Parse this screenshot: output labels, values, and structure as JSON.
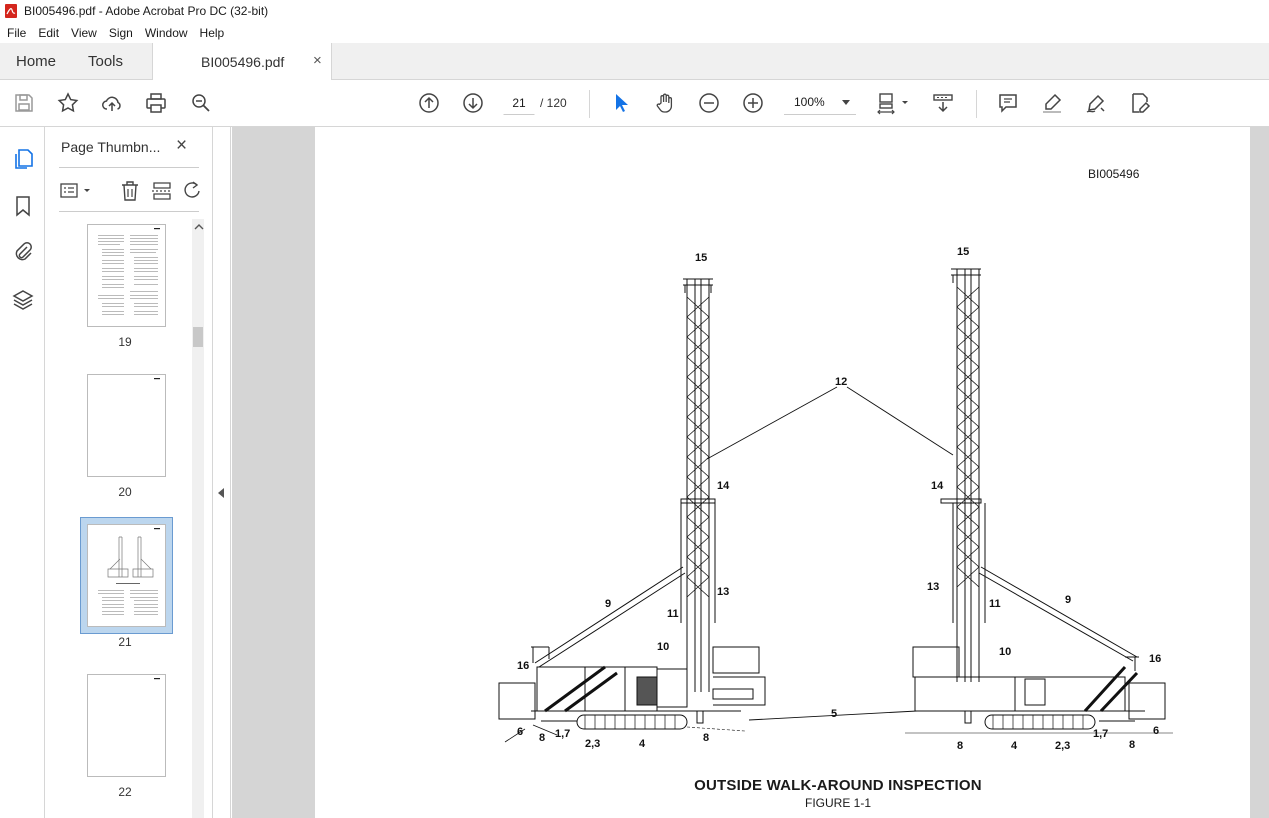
{
  "window": {
    "title": "BI005496.pdf - Adobe Acrobat Pro DC (32-bit)"
  },
  "menu": [
    "File",
    "Edit",
    "View",
    "Sign",
    "Window",
    "Help"
  ],
  "tabs": {
    "home": "Home",
    "tools": "Tools",
    "document": "BI005496.pdf",
    "close": "×"
  },
  "toolbar": {
    "current_page": "21",
    "page_total": "/ 120",
    "zoom": "100%"
  },
  "sidebar": {
    "title": "Page Thumbn...",
    "close": "×",
    "thumbnails": [
      {
        "label": "19"
      },
      {
        "label": "20"
      },
      {
        "label": "21",
        "selected": true
      },
      {
        "label": "22"
      }
    ]
  },
  "document": {
    "doc_id": "BI005496",
    "caption": "OUTSIDE WALK-AROUND INSPECTION",
    "figure": "FIGURE 1-1",
    "callouts_left": [
      "15",
      "12",
      "14",
      "13",
      "9",
      "11",
      "10",
      "16",
      "5",
      "6",
      "8",
      "1,7",
      "2,3",
      "4",
      "8"
    ],
    "callouts_right": [
      "15",
      "14",
      "13",
      "11",
      "9",
      "10",
      "16",
      "8",
      "4",
      "2,3",
      "1,7",
      "8",
      "6"
    ]
  }
}
